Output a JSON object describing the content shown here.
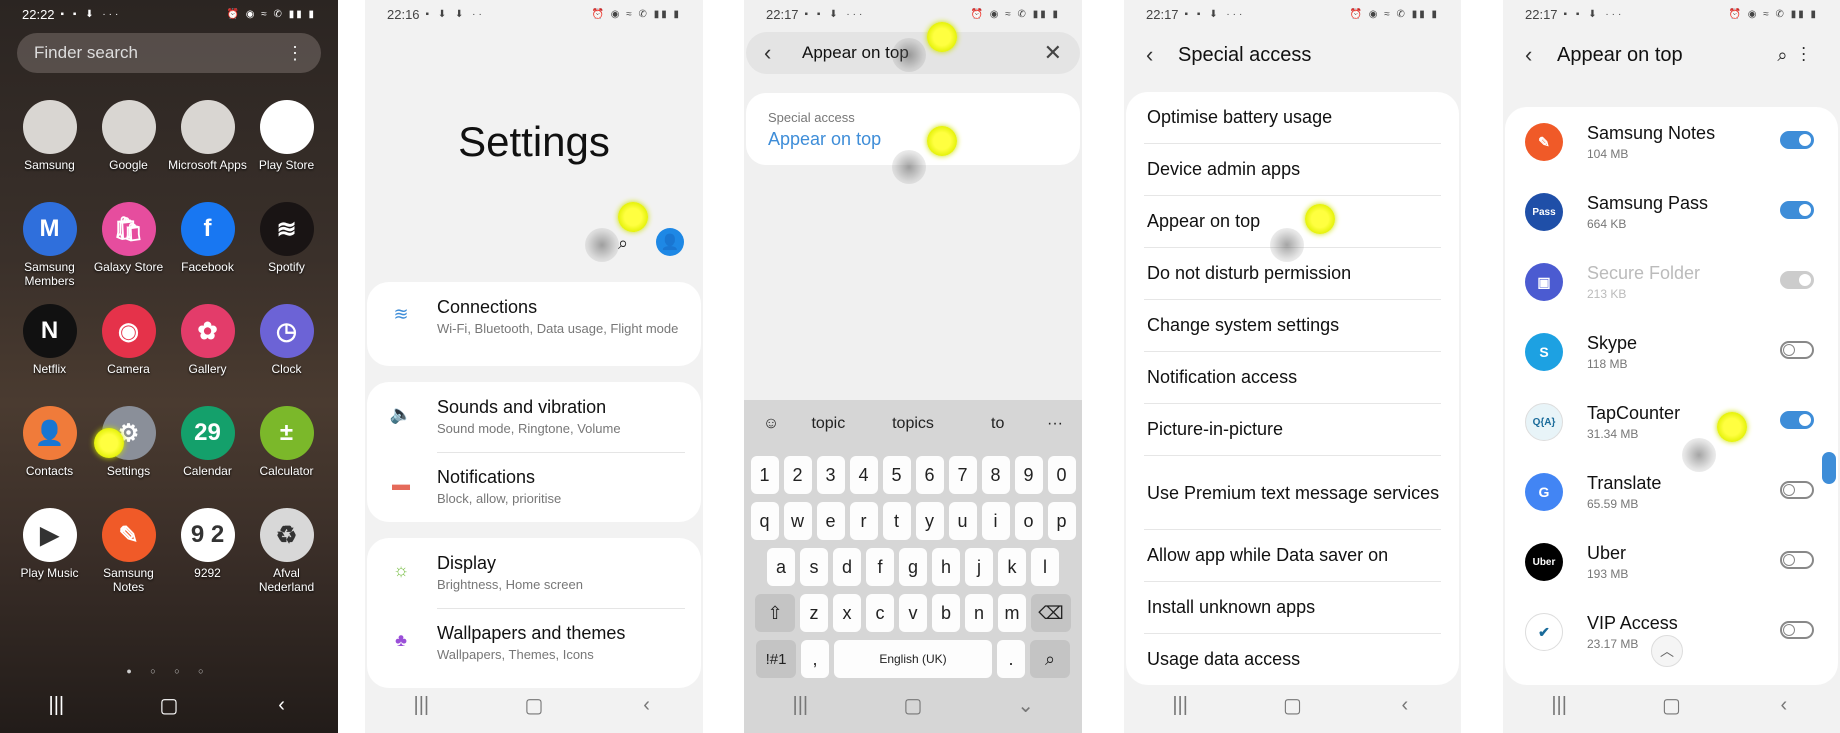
{
  "panels": {
    "home": {
      "status_time": "22:22",
      "status_icons_left": "▪ ▪ ⬇ ···",
      "status_icons_right": "⏰ ◉ ≈ ✆ ▮▮ ▮",
      "finder_placeholder": "Finder search",
      "finder_more": "⋮",
      "apps": [
        {
          "label": "Samsung",
          "color": "#d9d6d2"
        },
        {
          "label": "Google",
          "color": "#d9d6d2"
        },
        {
          "label": "Microsoft Apps",
          "color": "#d9d6d2"
        },
        {
          "label": "Play Store",
          "color": "#ffffff"
        },
        {
          "label": "Samsung Members",
          "color": "#2f6fdc",
          "glyph": "M"
        },
        {
          "label": "Galaxy Store",
          "color": "#e64d9e",
          "glyph": "🛍"
        },
        {
          "label": "Facebook",
          "color": "#1877f2",
          "glyph": "f"
        },
        {
          "label": "Spotify",
          "color": "#191414",
          "glyph": "≋"
        },
        {
          "label": "Netflix",
          "color": "#111111",
          "glyph": "N"
        },
        {
          "label": "Camera",
          "color": "#e5324a",
          "glyph": "◉"
        },
        {
          "label": "Gallery",
          "color": "#e33c6a",
          "glyph": "✿"
        },
        {
          "label": "Clock",
          "color": "#6c63d6",
          "glyph": "◷"
        },
        {
          "label": "Contacts",
          "color": "#f07b3a",
          "glyph": "👤"
        },
        {
          "label": "Settings",
          "color": "#8a8f99",
          "glyph": "⚙"
        },
        {
          "label": "Calendar",
          "color": "#14a06b",
          "glyph": "29"
        },
        {
          "label": "Calculator",
          "color": "#7bb82a",
          "glyph": "±"
        },
        {
          "label": "Play Music",
          "color": "#ffffff",
          "glyph": "▶"
        },
        {
          "label": "Samsung Notes",
          "color": "#f05a28",
          "glyph": "✎"
        },
        {
          "label": "9292",
          "color": "#ffffff",
          "glyph": "9 2"
        },
        {
          "label": "Afval Nederland",
          "color": "#d8d8d8",
          "glyph": "♻"
        }
      ],
      "page_dots": "● ○ ○ ○",
      "nav": [
        "|||",
        "▢",
        "‹"
      ]
    },
    "settings": {
      "status_time": "22:16",
      "status_icons_left": "▪ ⬇ ⬇ ··",
      "status_icons_right": "⏰ ◉ ≈ ✆ ▮▮ ▮",
      "title": "Settings",
      "search_icon": "⌕",
      "avatar_glyph": "👤",
      "groups": [
        [
          {
            "title": "Connections",
            "subtitle": "Wi-Fi, Bluetooth, Data usage, Flight mode",
            "icon": "wifi-icon",
            "glyph": "≋",
            "color": "#3e8dd8"
          }
        ],
        [
          {
            "title": "Sounds and vibration",
            "subtitle": "Sound mode, Ringtone, Volume",
            "icon": "speaker-icon",
            "glyph": "🔈",
            "color": "#6b6bd8"
          },
          {
            "title": "Notifications",
            "subtitle": "Block, allow, prioritise",
            "icon": "notifications-icon",
            "glyph": "▬",
            "color": "#e56a5a"
          }
        ],
        [
          {
            "title": "Display",
            "subtitle": "Brightness, Home screen",
            "icon": "sun-icon",
            "glyph": "☼",
            "color": "#7cc04a"
          },
          {
            "title": "Wallpapers and themes",
            "subtitle": "Wallpapers, Themes, Icons",
            "icon": "brush-icon",
            "glyph": "♣",
            "color": "#9a4fd8"
          }
        ]
      ],
      "nav": [
        "|||",
        "▢",
        "‹"
      ]
    },
    "search": {
      "status_time": "22:17",
      "status_icons_left": "▪ ▪ ⬇ ···",
      "status_icons_right": "⏰ ◉ ≈ ✆ ▮▮ ▮",
      "query": "Appear on top",
      "result_category": "Special access",
      "result_title": "Appear on top",
      "suggestions": [
        "topic",
        "topics",
        "to"
      ],
      "rows": [
        [
          "1",
          "2",
          "3",
          "4",
          "5",
          "6",
          "7",
          "8",
          "9",
          "0"
        ],
        [
          "q",
          "w",
          "e",
          "r",
          "t",
          "y",
          "u",
          "i",
          "o",
          "p"
        ],
        [
          "a",
          "s",
          "d",
          "f",
          "g",
          "h",
          "j",
          "k",
          "l"
        ],
        [
          "z",
          "x",
          "c",
          "v",
          "b",
          "n",
          "m"
        ]
      ],
      "sym_key": "!#1",
      "comma_key": ",",
      "space_label": "English (UK)",
      "period_key": ".",
      "nav": [
        "|||",
        "▢",
        "⌄"
      ]
    },
    "special": {
      "status_time": "22:17",
      "status_icons_left": "▪ ▪ ⬇ ···",
      "status_icons_right": "⏰ ◉ ≈ ✆ ▮▮ ▮",
      "title": "Special access",
      "items": [
        "Optimise battery usage",
        "Device admin apps",
        "Appear on top",
        "Do not disturb permission",
        "Change system settings",
        "Notification access",
        "Picture-in-picture",
        "Use Premium text message services",
        "Allow app while Data saver on",
        "Install unknown apps",
        "Usage data access"
      ],
      "nav": [
        "|||",
        "▢",
        "‹"
      ]
    },
    "appear": {
      "status_time": "22:17",
      "status_icons_left": "▪ ▪ ⬇ ···",
      "status_icons_right": "⏰ ◉ ≈ ✆ ▮▮ ▮",
      "title": "Appear on top",
      "apps": [
        {
          "name": "Samsung Notes",
          "size": "104 MB",
          "state": "on",
          "color": "#f05a28",
          "glyph": "✎"
        },
        {
          "name": "Samsung Pass",
          "size": "664 KB",
          "state": "on",
          "color": "#1f4fa8",
          "glyph": "Pass"
        },
        {
          "name": "Secure Folder",
          "size": "213 KB",
          "state": "disabled",
          "color": "#4b5bd1",
          "glyph": "▣"
        },
        {
          "name": "Skype",
          "size": "118 MB",
          "state": "off",
          "color": "#1da1e2",
          "glyph": "S"
        },
        {
          "name": "TapCounter",
          "size": "31.34 MB",
          "state": "on",
          "color": "#e8f4f8",
          "glyph": "Q{A}"
        },
        {
          "name": "Translate",
          "size": "65.59 MB",
          "state": "off",
          "color": "#4285f4",
          "glyph": "G"
        },
        {
          "name": "Uber",
          "size": "193 MB",
          "state": "off",
          "color": "#000000",
          "glyph": "Uber"
        },
        {
          "name": "VIP Access",
          "size": "23.17 MB",
          "state": "off",
          "color": "#ffffff",
          "glyph": "✔"
        }
      ],
      "nav": [
        "|||",
        "▢",
        "‹"
      ]
    }
  }
}
